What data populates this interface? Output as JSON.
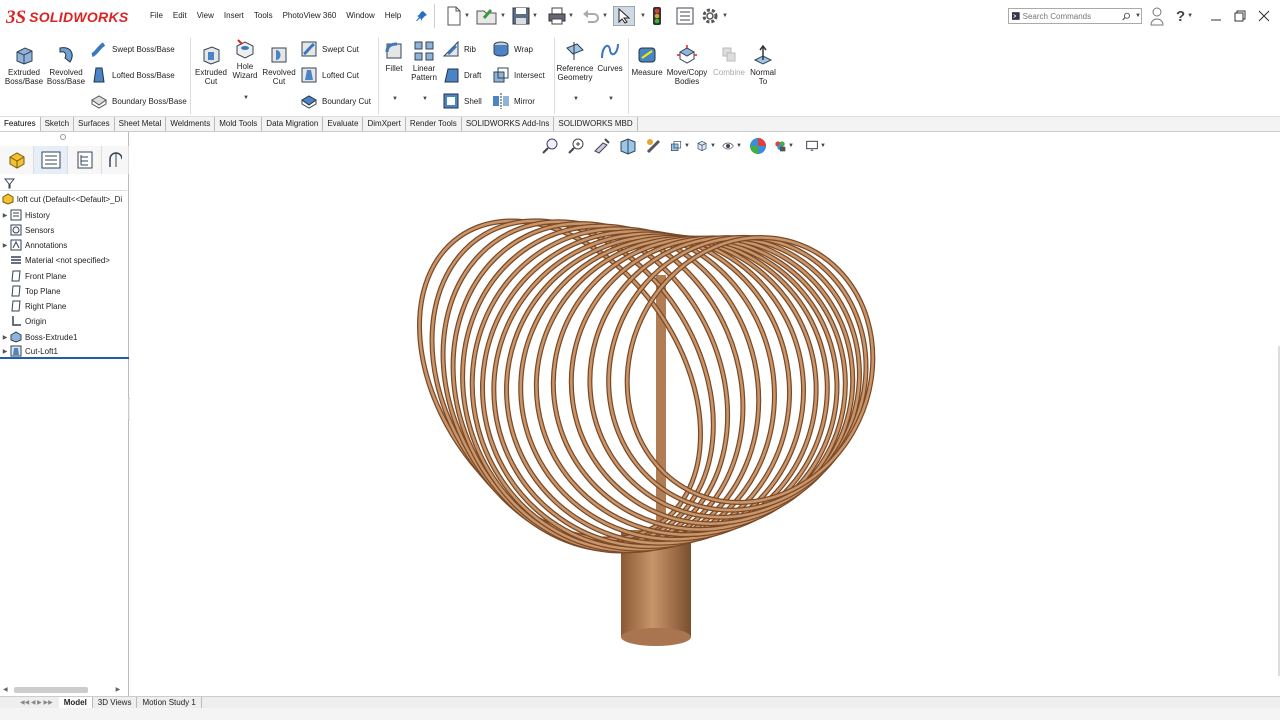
{
  "app": {
    "brand": "SOLIDWORKS",
    "ds_mark": "3S"
  },
  "menu": [
    "File",
    "Edit",
    "View",
    "Insert",
    "Tools",
    "PhotoView 360",
    "Window",
    "Help"
  ],
  "search": {
    "placeholder": "Search Commands"
  },
  "ribbon": {
    "extruded_boss": "Extruded Boss/Base",
    "revolved_boss": "Revolved Boss/Base",
    "swept_boss": "Swept Boss/Base",
    "lofted_boss": "Lofted Boss/Base",
    "boundary_boss": "Boundary Boss/Base",
    "extruded_cut": "Extruded Cut",
    "hole_wizard": "Hole Wizard",
    "revolved_cut": "Revolved Cut",
    "swept_cut": "Swept Cut",
    "lofted_cut": "Lofted Cut",
    "boundary_cut": "Boundary Cut",
    "fillet": "Fillet",
    "linear_pattern": "Linear Pattern",
    "rib": "Rib",
    "draft": "Draft",
    "shell": "Shell",
    "wrap": "Wrap",
    "intersect": "Intersect",
    "mirror": "Mirror",
    "reference_geometry": "Reference Geometry",
    "curves": "Curves",
    "measure": "Measure",
    "move_copy": "Move/Copy Bodies",
    "combine": "Combine",
    "normal_to": "Normal To"
  },
  "tabs": [
    "Features",
    "Sketch",
    "Surfaces",
    "Sheet Metal",
    "Weldments",
    "Mold Tools",
    "Data Migration",
    "Evaluate",
    "DimXpert",
    "Render Tools",
    "SOLIDWORKS Add-Ins",
    "SOLIDWORKS MBD"
  ],
  "tree": {
    "root": "loft cut  (Default<<Default>_Di",
    "items": [
      "History",
      "Sensors",
      "Annotations",
      "Material <not specified>",
      "Front Plane",
      "Top Plane",
      "Right Plane",
      "Origin",
      "Boss-Extrude1",
      "Cut-Loft1"
    ]
  },
  "bottom_tabs": [
    "Model",
    "3D Views",
    "Motion Study 1"
  ],
  "colors": {
    "accent": "#1f5ea8",
    "brand_red": "#d22222",
    "model": "#b8845a"
  }
}
